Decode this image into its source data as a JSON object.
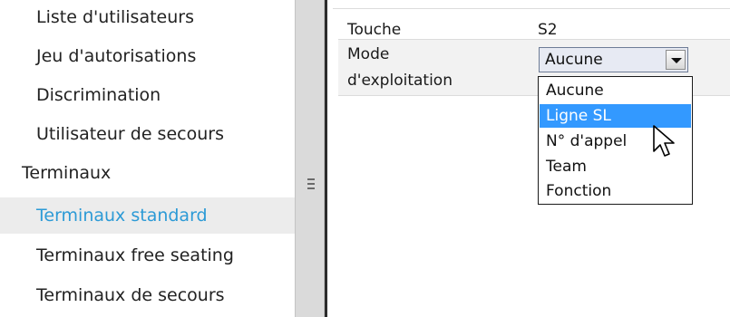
{
  "sidebar": {
    "items": [
      {
        "label": "Liste d'utilisateurs"
      },
      {
        "label": "Jeu d'autorisations"
      },
      {
        "label": "Discrimination"
      },
      {
        "label": "Utilisateur de secours"
      },
      {
        "label": "Terminaux"
      },
      {
        "label": "Terminaux standard"
      },
      {
        "label": "Terminaux free seating"
      },
      {
        "label": "Terminaux de secours"
      }
    ],
    "selected_index": 5
  },
  "properties": {
    "key_label": "Touche",
    "key_value": "S2",
    "mode_label_line1": "Mode",
    "mode_label_line2": "d'exploitation",
    "mode_value": "Aucune"
  },
  "dropdown": {
    "options": [
      "Aucune",
      "Ligne SL",
      "N° d'appel",
      "Team",
      "Fonction"
    ],
    "highlighted_index": 1
  },
  "colors": {
    "selected_text": "#2c9ad6",
    "highlight": "#3399ff"
  }
}
